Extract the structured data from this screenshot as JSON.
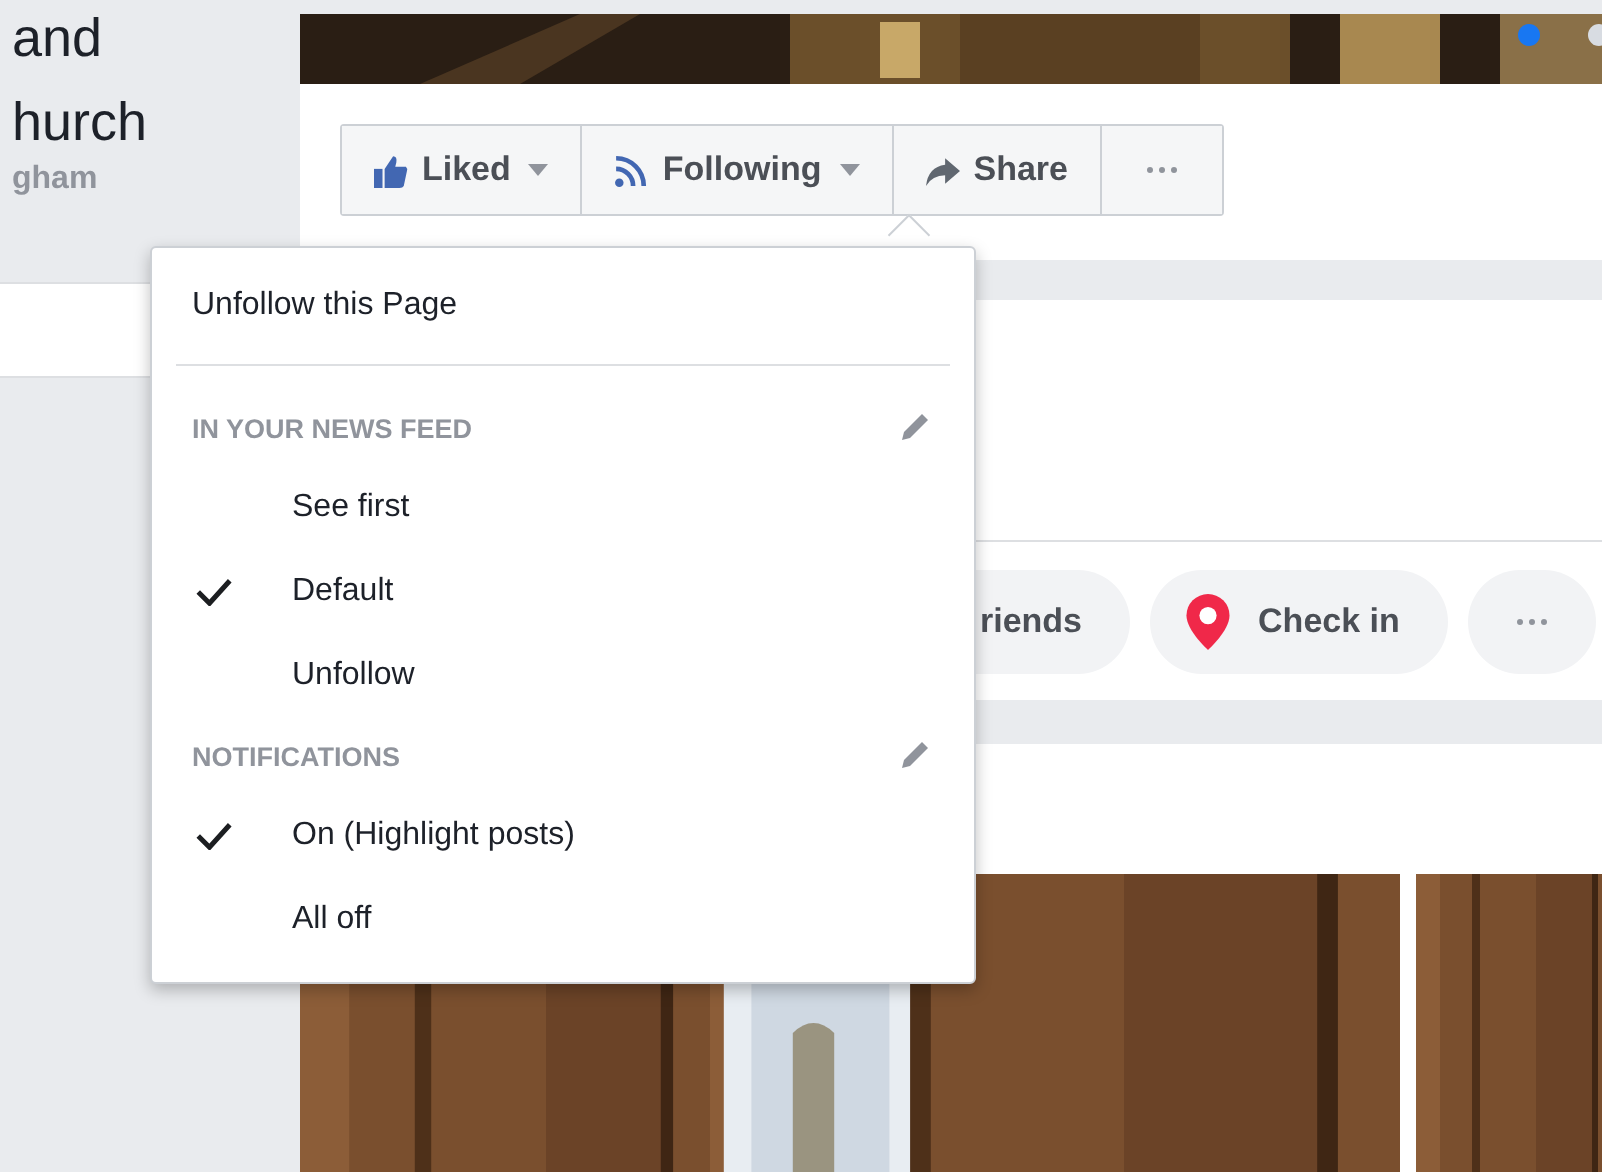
{
  "page_header": {
    "name_lines": [
      "and",
      "hurch"
    ],
    "location": "gham"
  },
  "cover": {
    "kind": "picture",
    "slides": [
      {
        "selected": true
      },
      {
        "selected": false
      }
    ]
  },
  "actions": [
    {
      "kind": "like",
      "label": "Liked",
      "dropdown": true
    },
    {
      "kind": "follow",
      "label": "Following",
      "dropdown": true
    },
    {
      "kind": "share",
      "label": "Share",
      "dropdown": false
    },
    {
      "kind": "more"
    }
  ],
  "follow_menu": {
    "top_action": "Unfollow this Page",
    "sections": [
      {
        "heading": "IN YOUR NEWS FEED",
        "options": [
          {
            "label": "See first",
            "selected": false
          },
          {
            "label": "Default",
            "selected": true
          },
          {
            "label": "Unfollow",
            "selected": false
          }
        ]
      },
      {
        "heading": "NOTIFICATIONS",
        "options": [
          {
            "label": "On (Highlight posts)",
            "selected": true
          },
          {
            "label": "All off",
            "selected": false
          }
        ]
      }
    ]
  },
  "quick_actions": [
    {
      "kind": "friends",
      "label": "riends"
    },
    {
      "kind": "checkin",
      "label": "Check in"
    },
    {
      "kind": "more"
    }
  ]
}
